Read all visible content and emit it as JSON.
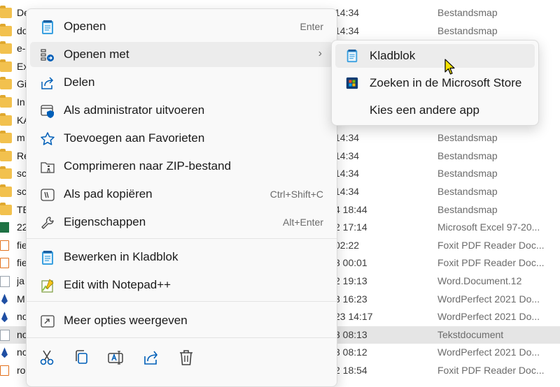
{
  "files": [
    {
      "name": "De",
      "icon": "folder",
      "date": "14:34",
      "type": "Bestandsmap"
    },
    {
      "name": "do",
      "icon": "folder",
      "date": "14:34",
      "type": "Bestandsmap"
    },
    {
      "name": "e-",
      "icon": "folder",
      "date": "",
      "type": ""
    },
    {
      "name": "Ex",
      "icon": "folder",
      "date": "",
      "type": ""
    },
    {
      "name": "Gi",
      "icon": "folder",
      "date": "",
      "type": ""
    },
    {
      "name": "In",
      "icon": "folder",
      "date": "",
      "type": ""
    },
    {
      "name": "KA",
      "icon": "folder",
      "date": "",
      "type": ""
    },
    {
      "name": "m",
      "icon": "folder",
      "date": "14:34",
      "type": "Bestandsmap"
    },
    {
      "name": "Re",
      "icon": "folder",
      "date": "14:34",
      "type": "Bestandsmap"
    },
    {
      "name": "sc",
      "icon": "folder",
      "date": "14:34",
      "type": "Bestandsmap"
    },
    {
      "name": "sc",
      "icon": "folder",
      "date": "14:34",
      "type": "Bestandsmap"
    },
    {
      "name": "TE",
      "icon": "folder",
      "date": "4 18:44",
      "type": "Bestandsmap"
    },
    {
      "name": "22",
      "icon": "excel",
      "date": "2 17:14",
      "type": "Microsoft Excel 97-20..."
    },
    {
      "name": "fie",
      "icon": "pdf",
      "date": "02:22",
      "type": "Foxit PDF Reader Doc..."
    },
    {
      "name": "fie",
      "icon": "pdf",
      "date": "3 00:01",
      "type": "Foxit PDF Reader Doc..."
    },
    {
      "name": "ja",
      "icon": "word",
      "date": "2 19:13",
      "type": "Word.Document.12"
    },
    {
      "name": "M",
      "icon": "wp",
      "date": "3 16:23",
      "type": "WordPerfect 2021 Do..."
    },
    {
      "name": "no",
      "icon": "wp",
      "date": "23 14:17",
      "type": "WordPerfect 2021 Do..."
    },
    {
      "name": "no",
      "icon": "txt",
      "date": "3 08:13",
      "type": "Tekstdocument",
      "selected": true
    },
    {
      "name": "no",
      "icon": "wp",
      "date": "3 08:12",
      "type": "WordPerfect 2021 Do..."
    },
    {
      "name": "ro",
      "icon": "pdf",
      "date": "2 18:54",
      "type": "Foxit PDF Reader Doc..."
    }
  ],
  "menu": {
    "open": {
      "label": "Openen",
      "shortcut": "Enter"
    },
    "open_with": {
      "label": "Openen met",
      "arrow": "›"
    },
    "share": {
      "label": "Delen"
    },
    "run_as_admin": {
      "label": "Als administrator uitvoeren"
    },
    "add_favorites": {
      "label": "Toevoegen aan Favorieten"
    },
    "compress_zip": {
      "label": "Comprimeren naar ZIP-bestand"
    },
    "copy_path": {
      "label": "Als pad kopiëren",
      "shortcut": "Ctrl+Shift+C"
    },
    "properties": {
      "label": "Eigenschappen",
      "shortcut": "Alt+Enter"
    },
    "edit_notepad": {
      "label": "Bewerken in Kladblok"
    },
    "edit_notepadpp": {
      "label": "Edit with Notepad++"
    },
    "more_options": {
      "label": "Meer opties weergeven"
    }
  },
  "submenu": {
    "notepad": {
      "label": "Kladblok"
    },
    "store": {
      "label": "Zoeken in de Microsoft Store"
    },
    "other_app": {
      "label": "Kies een andere app"
    }
  },
  "colors": {
    "accent": "#005fb8",
    "hover": "#ececec",
    "selected_row": "#e5e5e5"
  }
}
